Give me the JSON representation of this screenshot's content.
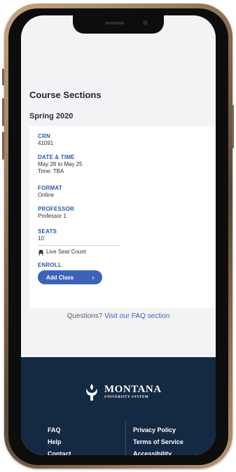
{
  "page": {
    "title": "Course Sections"
  },
  "term": {
    "title": "Spring 2020"
  },
  "section": {
    "crn_label": "CRN",
    "crn_value": "41091",
    "datetime_label": "DATE & TIME",
    "date_value": "May 28 to May 25",
    "time_value": "Time: TBA",
    "format_label": "FORMAT",
    "format_value": "Online",
    "professor_label": "PROFESSOR",
    "professor_value": "Professor 1",
    "seats_label": "SEATS",
    "seats_value": "10",
    "live_seat_text": "Live Seat Count",
    "enroll_label": "ENROLL",
    "add_class_label": "Add Class"
  },
  "faq": {
    "prefix": "Questions?",
    "link": "Visit our FAQ section"
  },
  "footer": {
    "logo_main": "MONTANA",
    "logo_sub": "UNIVERSITY SYSTEM",
    "left_links": [
      "FAQ",
      "Help",
      "Contact"
    ],
    "right_links": [
      "Privacy Policy",
      "Terms of Service",
      "Accessibility"
    ]
  },
  "colors": {
    "accent": "#3d63b8",
    "label_blue": "#2b5aa3",
    "footer_bg": "#142a43",
    "screen_bg": "#f3f3f5"
  },
  "icons": {
    "seat": "seat-icon",
    "chevron": "chevron-right-icon",
    "logo": "torch-icon"
  }
}
